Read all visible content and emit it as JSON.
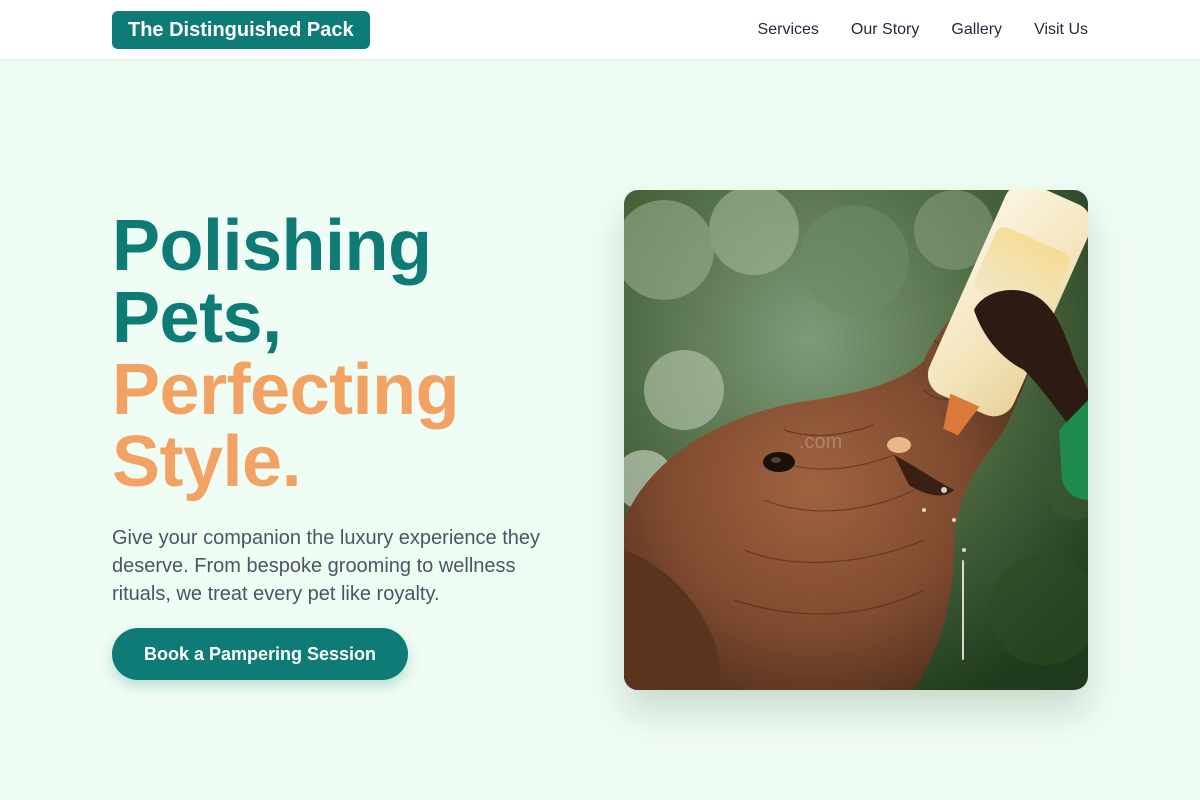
{
  "header": {
    "brand": "The Distinguished Pack",
    "nav": [
      "Services",
      "Our Story",
      "Gallery",
      "Visit Us"
    ]
  },
  "hero": {
    "headline_primary": [
      "Polishing",
      "Pets,"
    ],
    "headline_accent": [
      "Perfecting",
      "Style."
    ],
    "description": "Give your companion the luxury experience they deserve. From bespoke grooming to wellness rituals, we treat every pet like royalty.",
    "cta_label": "Book a Pampering Session",
    "image_subject": "elephant-calf-bottle-feeding-photo"
  },
  "colors": {
    "brand_teal": "#0f7b76",
    "accent_orange": "#f2a263",
    "background": "#f0fdf4",
    "body_text": "#4b5563"
  }
}
